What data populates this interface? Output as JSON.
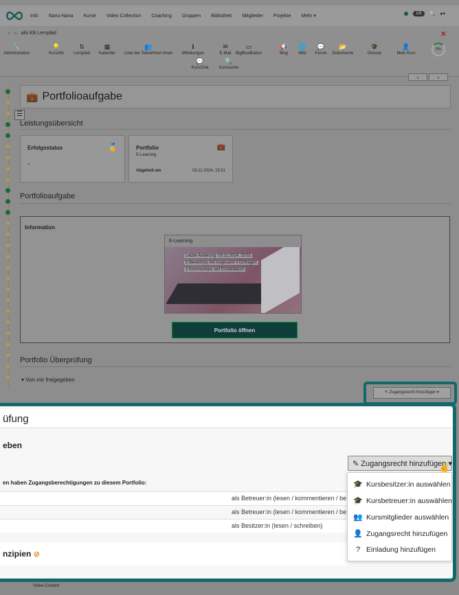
{
  "nav": {
    "items": [
      "Info",
      "Nanu-Nana",
      "Kurse",
      "Video Collection",
      "Coaching",
      "Gruppen",
      "Bibliothek",
      "Mitglieder",
      "Projekte",
      "Mehr ▾"
    ],
    "badge": "1/5"
  },
  "breadcrumb": {
    "label": "alis KB Lernpfad"
  },
  "toolbar": {
    "tools": [
      {
        "label": "Administration",
        "icon": "🔧"
      },
      {
        "label": "Kursinfo",
        "icon": "💡"
      },
      {
        "label": "Lernpfad",
        "icon": "⇅"
      },
      {
        "label": "Kalender",
        "icon": "▦"
      },
      {
        "label": "Liste der Teilnehmer:innen",
        "icon": "👥"
      },
      {
        "label": "Mitteilungen",
        "icon": "ℹ"
      },
      {
        "label": "E-Mail",
        "icon": "✉"
      },
      {
        "label": "BigBlueButton",
        "icon": "▭"
      },
      {
        "label": "Blog",
        "icon": "📢"
      },
      {
        "label": "Wiki",
        "icon": "🌐"
      },
      {
        "label": "Forum",
        "icon": "💬"
      },
      {
        "label": "Dokumente",
        "icon": "📂"
      },
      {
        "label": "Glossar",
        "icon": "🎓"
      },
      {
        "label": "Mein Kurs",
        "icon": "👤"
      },
      {
        "label": "KursChat",
        "icon": "💬"
      },
      {
        "label": "Kurssuche",
        "icon": "🔍"
      }
    ],
    "progress": "0%"
  },
  "page": {
    "title": "Portfolioaufgabe",
    "summary_title": "Leistungsübersicht",
    "success_card": {
      "label": "Erfolgsstatus",
      "value": "-"
    },
    "portfolio_card": {
      "label": "Portfolio",
      "sub": "E-Learning",
      "fetched_label": "Abgeholt am",
      "fetched_value": "03.11.2024, 15:51"
    },
    "task_title": "Portfolioaufgabe",
    "info_label": "Information",
    "thumb": {
      "caption": "E-Learning",
      "lines": [
        "Letzte Änderung: 03.11.2024, 15:51",
        "5 Bereich(e) mit insgesamt 4 Einträgen",
        "2 Kommentare seit Erstelldatum"
      ]
    },
    "open_button": "Portfolio öffnen",
    "review_title": "Portfolio Überprüfung",
    "shared_toggle": "▾ Von mir freigegeben",
    "add_access_small": "✎ Zugangsrecht hinzufügen ▾"
  },
  "zoom": {
    "title": "üfung",
    "subtitle": "eben",
    "add_button": "✎ Zugangsrecht hinzufügen ▾",
    "note": "en haben Zugangsberechtigungen zu diesem Portfolio:",
    "rows": [
      "als Betreuer:in (lesen / kommentieren / be",
      "als Betreuer:in (lesen / kommentieren / be",
      "als Besitzer:in (lesen / schreiben)"
    ],
    "section": "nzipien",
    "menu": [
      {
        "label": "Kursbesitzer:in auswählen",
        "icon": "graduation-cap-icon"
      },
      {
        "label": "Kursbetreuer:in auswählen",
        "icon": "graduation-cap-icon"
      },
      {
        "label": "Kursmitglieder auswählen",
        "icon": "users-icon"
      },
      {
        "label": "Zugangsrecht hinzufügen",
        "icon": "user-icon"
      },
      {
        "label": "Einladung hinzufügen",
        "icon": "question-icon"
      }
    ]
  },
  "footer": {
    "label": "Video-Content"
  },
  "colors": {
    "accent": "#126969",
    "button": "#0f3d3a"
  }
}
